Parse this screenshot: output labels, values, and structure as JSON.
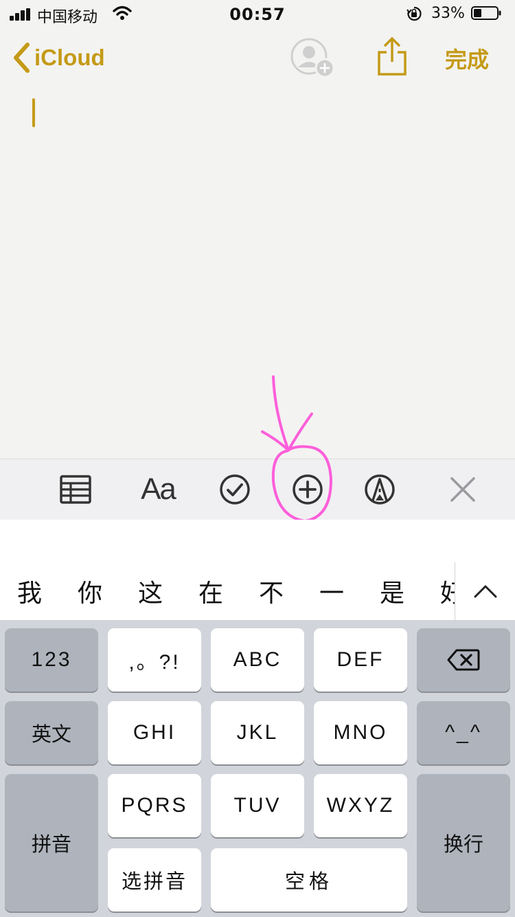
{
  "status_bar": {
    "carrier": "中国移动",
    "time": "00:57",
    "battery": "33%"
  },
  "nav": {
    "back_label": "iCloud",
    "done_label": "完成"
  },
  "toolbar": {
    "text_style_label": "Aa"
  },
  "candidates": [
    "我",
    "你",
    "这",
    "在",
    "不",
    "一",
    "是",
    "好"
  ],
  "keyboard": {
    "num": "123",
    "punct": ",。?!",
    "abc": "ABC",
    "def": "DEF",
    "eng": "英文",
    "ghi": "GHI",
    "jkl": "JKL",
    "mno": "MNO",
    "emoji": "^_^",
    "pinyin": "拼音",
    "pqrs": "PQRS",
    "tuv": "TUV",
    "wxyz": "WXYZ",
    "return": "换行",
    "select_pinyin": "选拼音",
    "space": "空格"
  },
  "colors": {
    "accent": "#c49a17",
    "annotation": "#ff4fd8"
  }
}
